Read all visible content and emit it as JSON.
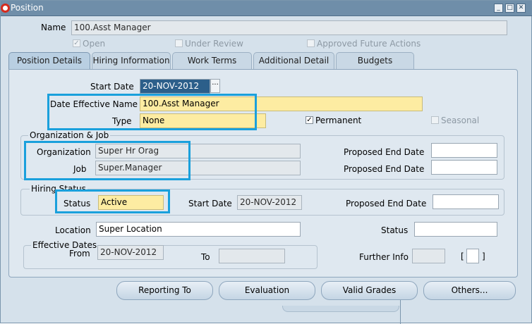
{
  "window": {
    "title": "Position"
  },
  "name": {
    "label": "Name",
    "value": "100.Asst Manager"
  },
  "flags": {
    "open_label": "Open",
    "open_checked": "✓",
    "under_review_label": "Under Review",
    "approved_label": "Approved Future Actions"
  },
  "tabs": [
    {
      "label": "Position Details"
    },
    {
      "label": "Hiring Information"
    },
    {
      "label": "Work Terms"
    },
    {
      "label": "Additional Detail"
    },
    {
      "label": "Budgets"
    }
  ],
  "details": {
    "start_date_label": "Start Date",
    "start_date_value": "20-NOV-2012",
    "date_effective_name_label": "Date Effective Name",
    "date_effective_name_value": "100.Asst Manager",
    "type_label": "Type",
    "type_value": "None",
    "permanent_label": "Permanent",
    "permanent_checked": "✓",
    "seasonal_label": "Seasonal"
  },
  "org_job": {
    "group_label": "Organization & Job",
    "organization_label": "Organization",
    "organization_value": "Super Hr Orag",
    "job_label": "Job",
    "job_value": "Super.Manager",
    "proposed_end_date_label": "Proposed End Date"
  },
  "hiring_status": {
    "group_label": "Hiring Status",
    "status_label": "Status",
    "status_value": "Active",
    "start_date_label": "Start Date",
    "start_date_value": "20-NOV-2012",
    "proposed_end_date_label": "Proposed End Date"
  },
  "location": {
    "label": "Location",
    "value": "Super Location",
    "status_label": "Status"
  },
  "effective_dates": {
    "group_label": "Effective Dates",
    "from_label": "From",
    "from_value": "20-NOV-2012",
    "to_label": "To",
    "further_info_label": "Further Info",
    "bracket_open": "[",
    "bracket_close": "]"
  },
  "buttons": {
    "reporting_to": "Reporting To",
    "evaluation": "Evaluation",
    "valid_grades": "Valid Grades",
    "others": "Others..."
  },
  "colors": {
    "highlight": "#1aa0dc",
    "required_field": "#fdeca2",
    "titlebar": "#6f8ea9"
  }
}
